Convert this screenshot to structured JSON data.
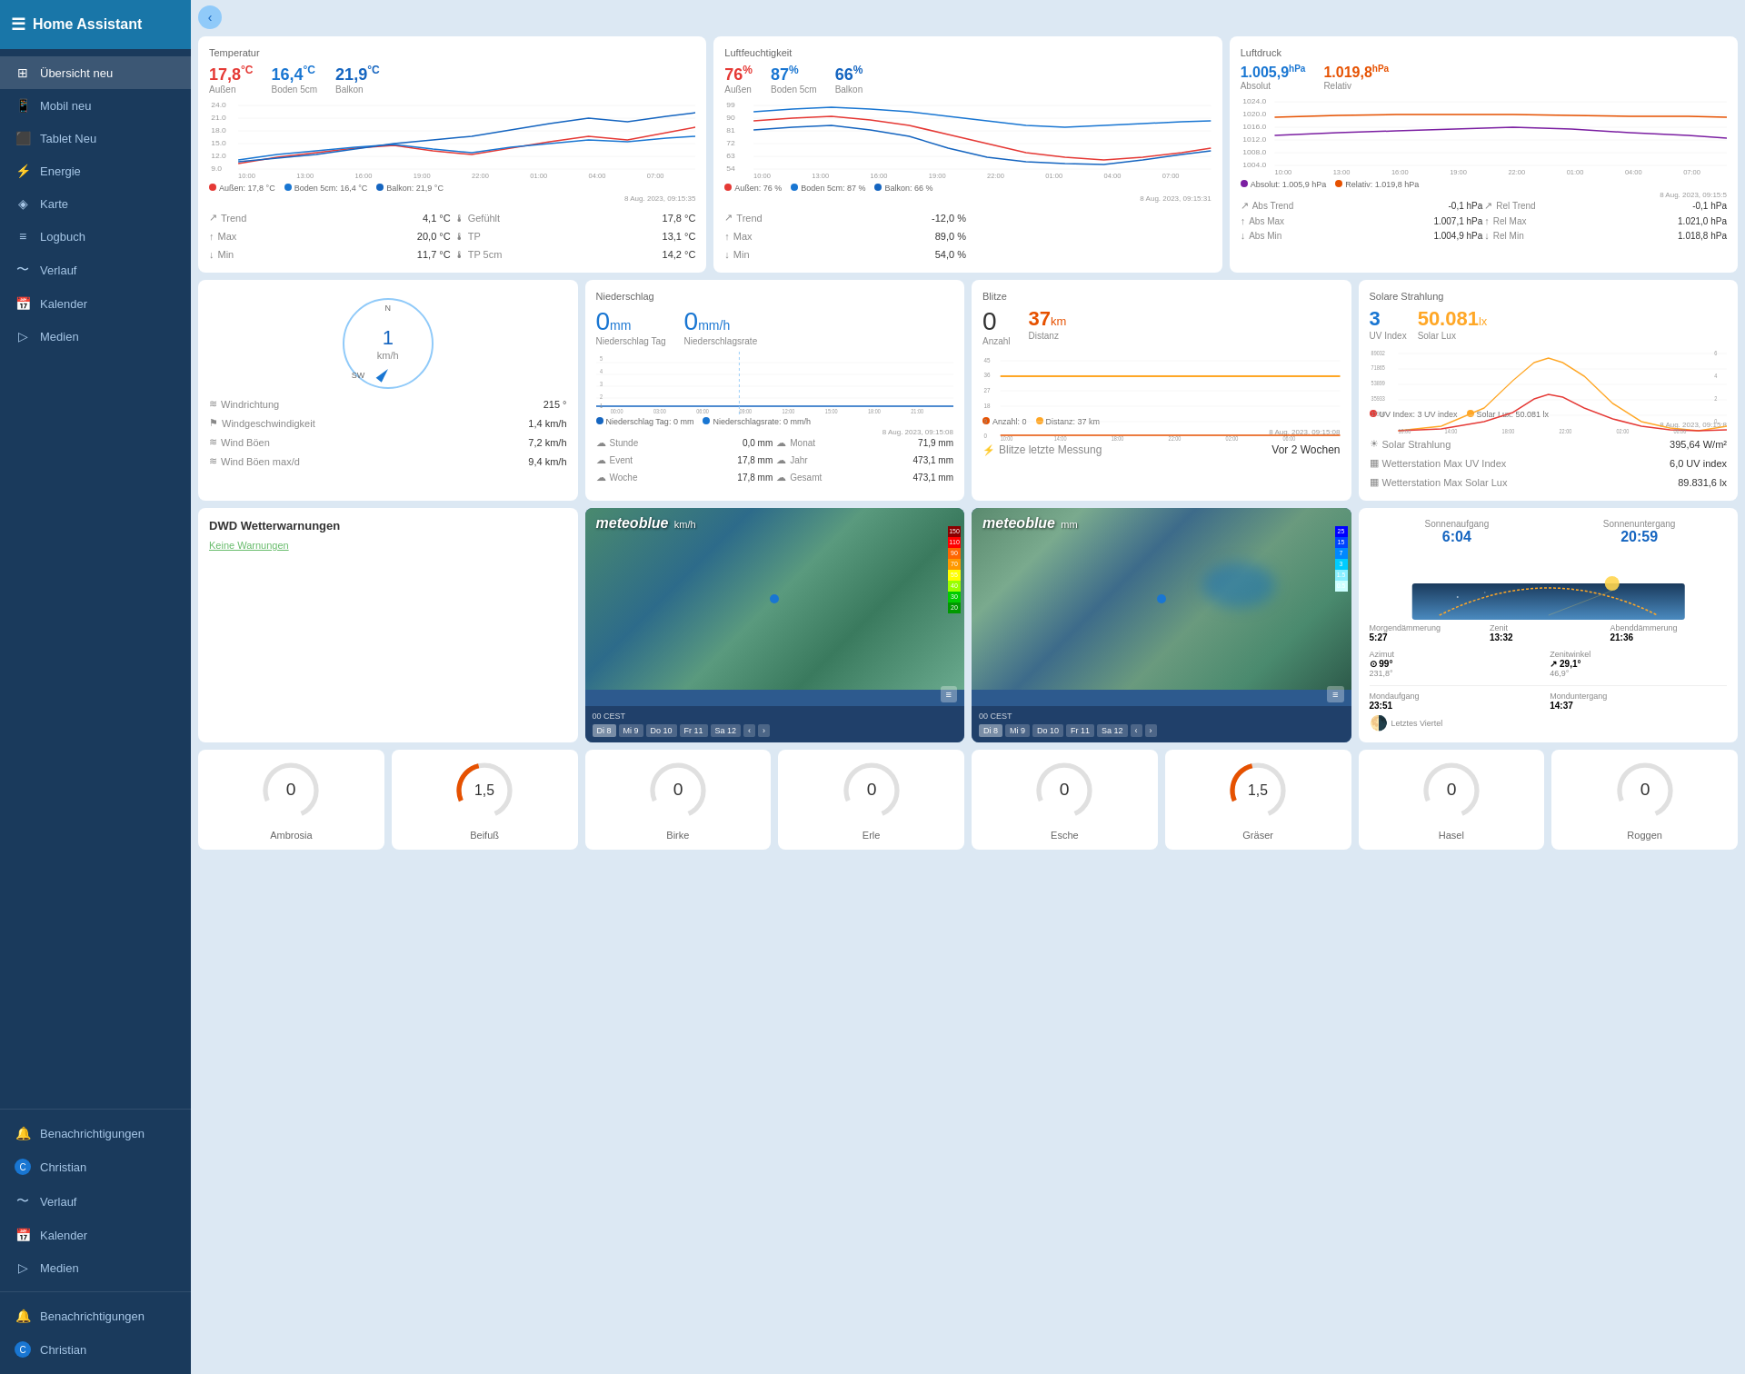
{
  "app": {
    "title": "Home Assistant"
  },
  "sidebar": {
    "nav_items": [
      {
        "id": "ubersicht",
        "label": "Übersicht neu",
        "icon": "⊞",
        "active": true
      },
      {
        "id": "mobil",
        "label": "Mobil neu",
        "icon": "☰",
        "active": false
      },
      {
        "id": "tablet",
        "label": "Tablet Neu",
        "icon": "□",
        "active": false
      },
      {
        "id": "energie",
        "label": "Energie",
        "icon": "⚡",
        "active": false
      },
      {
        "id": "karte",
        "label": "Karte",
        "icon": "♦",
        "active": false
      },
      {
        "id": "logbuch",
        "label": "Logbuch",
        "icon": "≡",
        "active": false
      },
      {
        "id": "verlauf",
        "label": "Verlauf",
        "icon": "〜",
        "active": false
      },
      {
        "id": "kalender",
        "label": "Kalender",
        "icon": "◫",
        "active": false
      },
      {
        "id": "medien",
        "label": "Medien",
        "icon": "▷",
        "active": false
      }
    ],
    "bottom_items": [
      {
        "id": "benachrichtigungen",
        "label": "Benachrichtigungen",
        "icon": "🔔"
      },
      {
        "id": "christian",
        "label": "Christian",
        "icon": "C"
      },
      {
        "id": "verlauf2",
        "label": "Verlauf",
        "icon": "〜"
      },
      {
        "id": "kalender2",
        "label": "Kalender",
        "icon": "◫"
      },
      {
        "id": "medien2",
        "label": "Medien",
        "icon": "▷"
      }
    ],
    "bottom2_items": [
      {
        "id": "benachrichtigungen2",
        "label": "Benachrichtigungen",
        "icon": "🔔"
      },
      {
        "id": "christian2",
        "label": "Christian",
        "icon": "C"
      }
    ]
  },
  "temperature": {
    "title": "Temperatur",
    "values": [
      {
        "label": "Außen",
        "value": "17,8",
        "unit": "°C",
        "color": "red"
      },
      {
        "label": "Boden 5cm",
        "value": "16,4",
        "unit": "°C",
        "color": "blue"
      },
      {
        "label": "Balkon",
        "value": "21,9",
        "unit": "°C",
        "color": "darkblue"
      }
    ],
    "stats_left": [
      {
        "icon": "↗",
        "label": "Trend",
        "value": "4,1 °C"
      },
      {
        "icon": "↑",
        "label": "Max",
        "value": "20,0 °C"
      },
      {
        "icon": "↓",
        "label": "Min",
        "value": "11,7 °C"
      }
    ],
    "stats_right": [
      {
        "icon": "🌡",
        "label": "Gefühlt",
        "value": "17,8 °C"
      },
      {
        "icon": "🌡",
        "label": "TP",
        "value": "13,1 °C"
      },
      {
        "icon": "🌡",
        "label": "TP 5cm",
        "value": "14,2 °C"
      }
    ],
    "date": "8 Aug. 2023, 09:15:35",
    "legend": [
      "Außen: 17,8 °C",
      "Boden 5cm: 16,4 °C",
      "Balkon: 21,9 °C"
    ],
    "legend_colors": [
      "#e53935",
      "#1976d2",
      "#1565c0"
    ]
  },
  "humidity": {
    "title": "Luftfeuchtigkeit",
    "values": [
      {
        "label": "Außen",
        "value": "76",
        "unit": "%",
        "color": "red"
      },
      {
        "label": "Boden 5cm",
        "value": "87",
        "unit": "%",
        "color": "blue"
      },
      {
        "label": "Balkon",
        "value": "66",
        "unit": "%",
        "color": "darkblue"
      }
    ],
    "stats_left": [
      {
        "icon": "↗",
        "label": "Trend",
        "value": "-12,0 %"
      },
      {
        "icon": "↑",
        "label": "Max",
        "value": "89,0 %"
      },
      {
        "icon": "↓",
        "label": "Min",
        "value": "54,0 %"
      }
    ],
    "date": "8 Aug. 2023, 09:15:31",
    "legend": [
      "Außen: 76 %",
      "Boden 5cm: 87 %",
      "Balkon: 66 %"
    ],
    "legend_colors": [
      "#e53935",
      "#1976d2",
      "#1565c0"
    ]
  },
  "pressure": {
    "title": "Luftdruck",
    "values": [
      {
        "label": "Absolut",
        "value": "1.005,9",
        "unit": "hPa",
        "color": "blue"
      },
      {
        "label": "Relativ",
        "value": "1.019,8",
        "unit": "hPa",
        "color": "orange"
      }
    ],
    "stats": [
      {
        "icon": "↗",
        "label": "Abs Trend",
        "value": "-0,1 hPa"
      },
      {
        "icon": "↗",
        "label": "Rel Trend",
        "value": "-0,1 hPa"
      },
      {
        "icon": "↑",
        "label": "Abs Max",
        "value": "1.007,1 hPa"
      },
      {
        "icon": "↑",
        "label": "Rel Max",
        "value": "1.021,0 hPa"
      },
      {
        "icon": "↓",
        "label": "Abs Min",
        "value": "1.004,9 hPa"
      },
      {
        "icon": "↓",
        "label": "Rel Min",
        "value": "1.018,8 hPa"
      }
    ],
    "date": "8 Aug. 2023, 09:15:5",
    "legend": [
      "Absolut: 1.005,9 hPa",
      "Relativ: 1.019,8 hPa"
    ],
    "legend_colors": [
      "#7b1fa2",
      "#e65100"
    ]
  },
  "wind": {
    "title": "",
    "speed": "1",
    "speed_unit": "km/h",
    "compass_n": "N",
    "compass_sw": "SW",
    "stats": [
      {
        "icon": "≋",
        "label": "Windrichtung",
        "value": "215 °"
      },
      {
        "icon": "⚑",
        "label": "Windgeschwindigkeit",
        "value": "1,4 km/h"
      },
      {
        "icon": "≋",
        "label": "Wind Böen",
        "value": "7,2 km/h"
      },
      {
        "icon": "≋",
        "label": "Wind Böen max/d",
        "value": "9,4 km/h"
      }
    ]
  },
  "rain": {
    "title": "Niederschlag",
    "day_value": "0",
    "day_unit": "mm",
    "day_label": "Niederschlag Tag",
    "rate_value": "0",
    "rate_unit": "mm/h",
    "rate_label": "Niederschlagsrate",
    "stats": [
      {
        "icon": "☁",
        "label": "Stunde",
        "value": "0,0 mm"
      },
      {
        "icon": "☁",
        "label": "Monat",
        "value": "71,9 mm"
      },
      {
        "icon": "☁",
        "label": "Event",
        "value": "17,8 mm"
      },
      {
        "icon": "☁",
        "label": "Jahr",
        "value": "473,1 mm"
      },
      {
        "icon": "☁",
        "label": "Woche",
        "value": "17,8 mm"
      },
      {
        "icon": "☁",
        "label": "Gesamt",
        "value": "473,1 mm"
      }
    ],
    "date": "8 Aug. 2023, 09:15:08",
    "legend": [
      "Niederschlag Tag: 0 mm",
      "Niederschlagsrate: 0 mm/h"
    ],
    "legend_colors": [
      "#1565c0",
      "#1976d2"
    ]
  },
  "lightning": {
    "title": "Blitze",
    "count_value": "0",
    "count_label": "Anzahl",
    "distance_value": "37",
    "distance_unit": "km",
    "distance_label": "Distanz",
    "stats": [
      {
        "icon": "⚡",
        "label": "Blitze letzte Messung",
        "value": "Vor 2 Wochen"
      }
    ],
    "date": "8 Aug. 2023, 09:15:08",
    "legend": [
      "Anzahl: 0",
      "Distanz: 37 km"
    ],
    "legend_colors": [
      "#e65100",
      "#ffa726"
    ]
  },
  "solar": {
    "title": "Solare Strahlung",
    "uv_value": "3",
    "uv_label": "UV Index",
    "lux_value": "50.081",
    "lux_unit": "lx",
    "lux_label": "Solar Lux",
    "stats": [
      {
        "icon": "☀",
        "label": "Solar Strahlung",
        "value": "395,64 W/m²"
      },
      {
        "icon": "▦",
        "label": "Wetterstation Max UV Index",
        "value": "6,0 UV index"
      },
      {
        "icon": "▦",
        "label": "Wetterstation Max Solar Lux",
        "value": "89.831,6 lx"
      }
    ],
    "date": "8 Aug. 2023, 09:15:8",
    "legend": [
      "UV Index: 3 UV index",
      "Solar Lux: 50.081 lx"
    ],
    "legend_colors": [
      "#e53935",
      "#ffa726"
    ]
  },
  "dwd": {
    "title": "DWD Wetterwarnungen",
    "warning_text": "Keine Warnungen"
  },
  "map1": {
    "title": "meteoblue",
    "timestamp": "00 CEST",
    "tabs": [
      "Di 8",
      "Mi 9",
      "Do 10",
      "Fr 11",
      "Sa 12"
    ],
    "active_tab": "Di 8"
  },
  "map2": {
    "title": "meteoblue",
    "timestamp": "00 CEST",
    "tabs": [
      "Di 8",
      "Mi 9",
      "Do 10",
      "Fr 11",
      "Sa 12"
    ],
    "active_tab": "Di 8"
  },
  "sun": {
    "sunrise_label": "Sonnenaufgang",
    "sunrise_value": "6:04",
    "sunset_label": "Sonnenuntergang",
    "sunset_value": "20:59",
    "dawn_label": "Morgendämmerung",
    "dawn_value": "5:27",
    "zenith_label": "Zenit",
    "zenith_value": "13:32",
    "dusk_label": "Abenddämmerung",
    "dusk_value": "21:36",
    "azimuth_label": "Azimut",
    "azimuth_value": "99°",
    "azimuth_sub": "231,8°",
    "zenith_angle_label": "Zenitwinkel",
    "zenith_angle_value": "29,1°",
    "zenith_angle_sub": "46,9°",
    "moonrise_label": "Mondaufgang",
    "moonrise_value": "23:51",
    "moon_phase_label": "Letztes Viertel",
    "moonset_label": "Monduntergang",
    "moonset_value": "14:37"
  },
  "pollen": [
    {
      "label": "Ambrosia",
      "value": "0",
      "color": "#ccc",
      "gauge": false
    },
    {
      "label": "Beifuß",
      "value": "1,5",
      "color": "#e65100",
      "gauge": true
    },
    {
      "label": "Birke",
      "value": "0",
      "color": "#ccc",
      "gauge": false
    },
    {
      "label": "Erle",
      "value": "0",
      "color": "#ccc",
      "gauge": false
    },
    {
      "label": "Esche",
      "value": "0",
      "color": "#ccc",
      "gauge": false
    },
    {
      "label": "Gräser",
      "value": "1,5",
      "color": "#e65100",
      "gauge": true
    },
    {
      "label": "Hasel",
      "value": "0",
      "color": "#ccc",
      "gauge": false
    },
    {
      "label": "Roggen",
      "value": "0",
      "color": "#ccc",
      "gauge": false
    }
  ]
}
